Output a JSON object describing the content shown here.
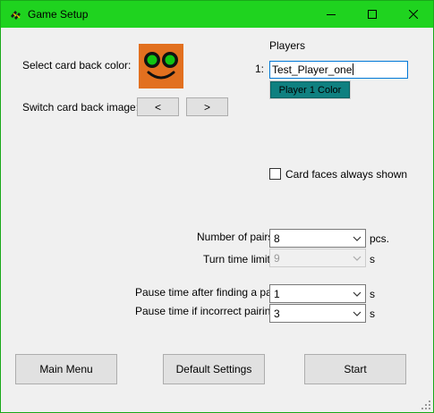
{
  "window": {
    "title": "Game Setup",
    "colors": {
      "titlebar": "#1fd31f",
      "background": "#f0f0f0",
      "accent_border": "#0078d7"
    }
  },
  "card_back": {
    "select_color_label": "Select card back color:",
    "switch_image_label": "Switch card back image:",
    "prev_label": "<",
    "next_label": ">",
    "preview_color": "#e2701f",
    "preview_icon": "smiley-face-icon"
  },
  "players": {
    "heading": "Players",
    "list": [
      {
        "index_label": "1:",
        "name": "Test_Player_one",
        "color_button_label": "Player 1 Color",
        "color": "#0f8080"
      }
    ]
  },
  "options": {
    "card_faces_label": "Card faces always shown",
    "card_faces_checked": false
  },
  "settings": {
    "pairs": {
      "label": "Number of pairs:",
      "value": "8",
      "unit": "pcs.",
      "enabled": true
    },
    "turn_time": {
      "label": "Turn time limit:",
      "value": "9",
      "unit": "s",
      "enabled": false
    },
    "pause_found": {
      "label": "Pause time after finding a pair:",
      "value": "1",
      "unit": "s",
      "enabled": true
    },
    "pause_incorrect": {
      "label": "Pause time if incorrect pairing:",
      "value": "3",
      "unit": "s",
      "enabled": true
    }
  },
  "footer": {
    "main_menu": "Main Menu",
    "default_settings": "Default Settings",
    "start": "Start"
  }
}
